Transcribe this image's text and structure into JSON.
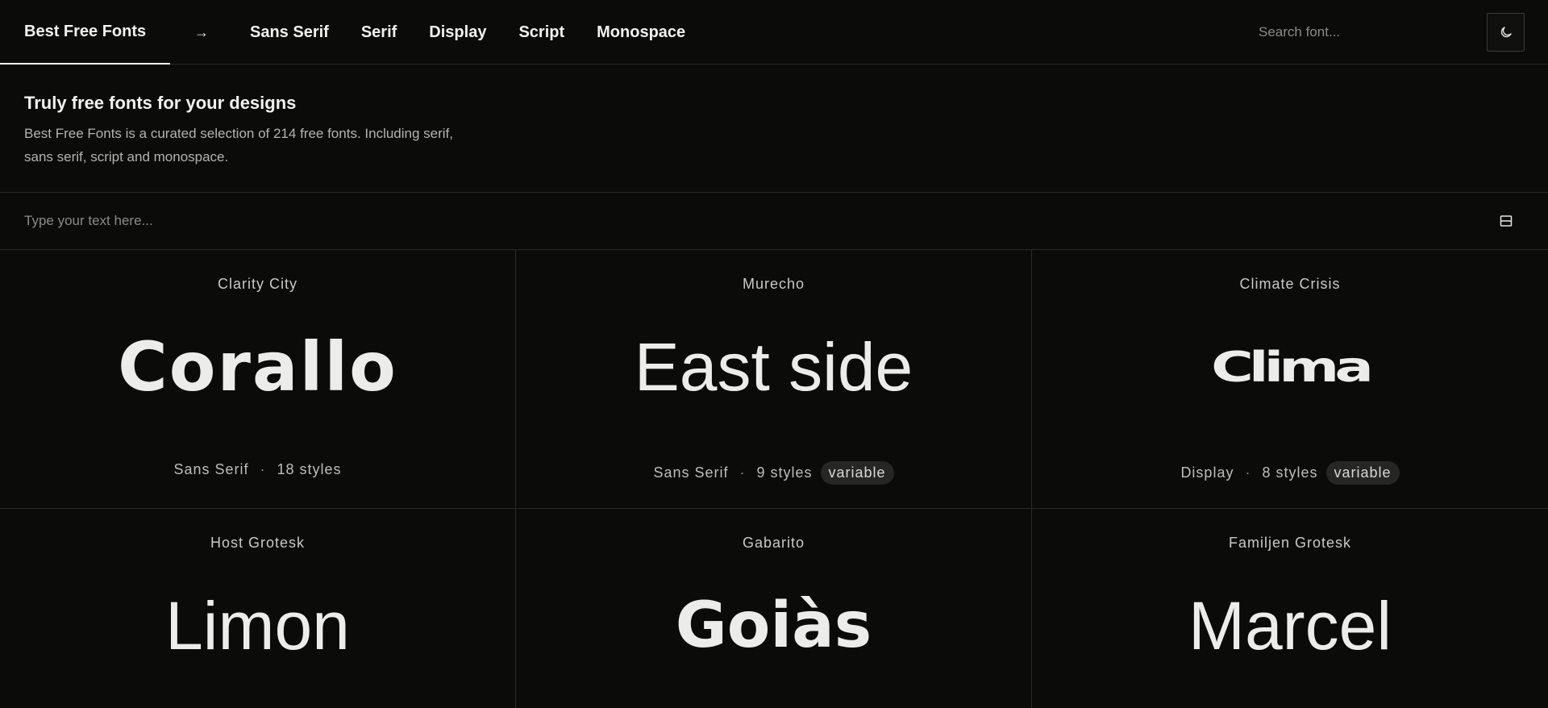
{
  "header": {
    "brand": "Best Free Fonts",
    "arrow_icon": "arrow-right-icon",
    "nav": [
      "Sans Serif",
      "Serif",
      "Display",
      "Script",
      "Monospace"
    ],
    "search_placeholder": "Search font...",
    "theme_icon": "moon-icon"
  },
  "intro": {
    "title": "Truly free fonts for your designs",
    "description": "Best Free Fonts is a curated selection of 214 free fonts. Including serif, sans serif, script and monospace."
  },
  "tester": {
    "placeholder": "Type your text here...",
    "layout_icon": "layout-toggle-icon"
  },
  "fonts": [
    {
      "name": "Clarity City",
      "sample": "Corallo",
      "category": "Sans Serif",
      "styles": "18 styles",
      "badge": ""
    },
    {
      "name": "Murecho",
      "sample": "East side",
      "category": "Sans Serif",
      "styles": "9 styles",
      "badge": "variable"
    },
    {
      "name": "Climate Crisis",
      "sample": "Clima",
      "category": "Display",
      "styles": "8 styles",
      "badge": "variable"
    },
    {
      "name": "Host Grotesk",
      "sample": "Limon"
    },
    {
      "name": "Gabarito",
      "sample": "Goiàs"
    },
    {
      "name": "Familjen Grotesk",
      "sample": "Marcel"
    }
  ],
  "colors": {
    "background": "#0b0b0a",
    "text": "#ececea",
    "muted": "#8a8a86",
    "border": "#2a2a28",
    "badge": "#262624"
  }
}
